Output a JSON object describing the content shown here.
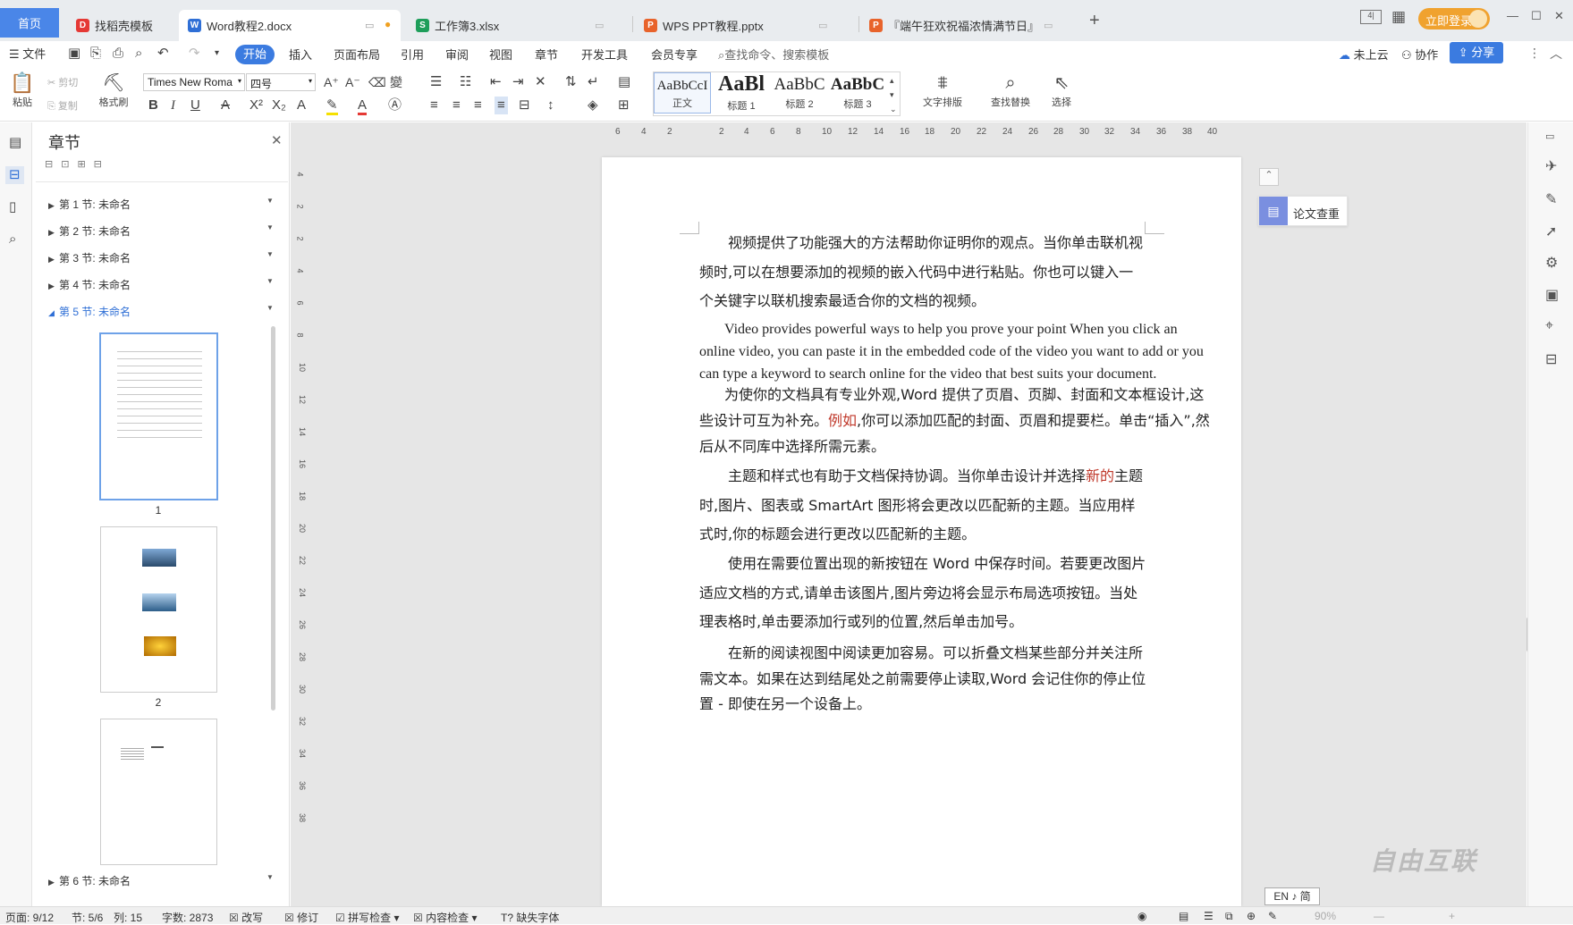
{
  "tabs": {
    "home": "首页",
    "templates": "找稻壳模板",
    "word": "Word教程2.docx",
    "excel": "工作簿3.xlsx",
    "ppt": "WPS PPT教程.pptx",
    "festival": "『端午狂欢祝福浓情满节日』",
    "add": "+"
  },
  "window": {
    "login": "立即登录",
    "min": "—",
    "max": "☐",
    "close": "✕"
  },
  "menu": {
    "file": "文件",
    "start": "开始",
    "insert": "插入",
    "layout": "页面布局",
    "reference": "引用",
    "review": "审阅",
    "view": "视图",
    "chapter": "章节",
    "developer": "开发工具",
    "member": "会员专享",
    "search": "查找命令、搜索模板",
    "cloud": "未上云",
    "collab": "协作",
    "share": "分享"
  },
  "ribbon": {
    "paste": "粘贴",
    "cut": "剪切",
    "copy": "复制",
    "format_painter": "格式刷",
    "font": "Times New Roma",
    "size": "四号",
    "styles": [
      {
        "preview": "AaBbCcI",
        "label": "正文"
      },
      {
        "preview": "AaBl",
        "label": "标题 1"
      },
      {
        "preview": "AaBbC",
        "label": "标题 2"
      },
      {
        "preview": "AaBbC",
        "label": "标题 3"
      }
    ],
    "text_layout": "文字排版",
    "find_replace": "查找替换",
    "select": "选择"
  },
  "panel": {
    "title": "章节",
    "sections": [
      "第 1 节: 未命名",
      "第 2 节: 未命名",
      "第 3 节: 未命名",
      "第 4 节: 未命名",
      "第 5 节: 未命名"
    ],
    "last_section": "第 6 节: 未命名",
    "page_numbers": [
      "1",
      "2"
    ]
  },
  "ruler": {
    "h": [
      "6",
      "4",
      "2",
      "2",
      "4",
      "6",
      "8",
      "10",
      "12",
      "14",
      "16",
      "18",
      "20",
      "22",
      "24",
      "26",
      "28",
      "30",
      "32",
      "34",
      "36",
      "38",
      "40"
    ],
    "v": [
      "4",
      "2",
      "2",
      "4",
      "6",
      "8",
      "10",
      "12",
      "14",
      "16",
      "18",
      "20",
      "22",
      "24",
      "26",
      "28",
      "30",
      "32",
      "34",
      "36",
      "38"
    ]
  },
  "document": {
    "p1": "视频提供了功能强大的方法帮助你证明你的观点。当你单击联机视频时,可以在想要添加的视频的嵌入代码中进行粘贴。你也可以键入一个关键字以联机搜索最适合你的文档的视频。",
    "p2": "Video provides powerful ways to help you prove your point When you click an online video, you can paste it in the embedded code of the video you want to add or you can type a keyword to search online for the video that best suits your document.",
    "p3a": "为使你的文档具有专业外观,Word 提供了页眉、页脚、封面和文本框设计,这些设计可互为补充。",
    "p3red": "例如",
    "p3b": ",你可以添加匹配的封面、页眉和提要栏。单击“插入”,然后从不同库中选择所需元素。",
    "p4a": "主题和样式也有助于文档保持协调。当你单击设计并选择",
    "p4red": "新的",
    "p4b": "主题时,图片、图表或 SmartArt 图形将会更改以匹配新的主题。当应用样式时,你的标题会进行更改以匹配新的主题。",
    "p5": "使用在需要位置出现的新按钮在 Word 中保存时间。若要更改图片适应文档的方式,请单击该图片,图片旁边将会显示布局选项按钮。当处理表格时,单击要添加行或列的位置,然后单击加号。",
    "p6": "在新的阅读视图中阅读更加容易。可以折叠文档某些部分并关注所需文本。如果在达到结尾处之前需要停止读取,Word 会记住你的停止位置 - 即使在另一个设备上。"
  },
  "side_tool": {
    "label": "论文查重"
  },
  "ime": "EN ♪ 简",
  "watermark": "自由互联",
  "status": {
    "page": "页面: 9/12",
    "section": "节: 5/6",
    "col": "列: 15",
    "words": "字数: 2873",
    "overtype": "改写",
    "revise": "修订",
    "spell": "拼写检查",
    "content_check": "内容检查",
    "missing_font": "缺失字体",
    "zoom": "90%"
  }
}
